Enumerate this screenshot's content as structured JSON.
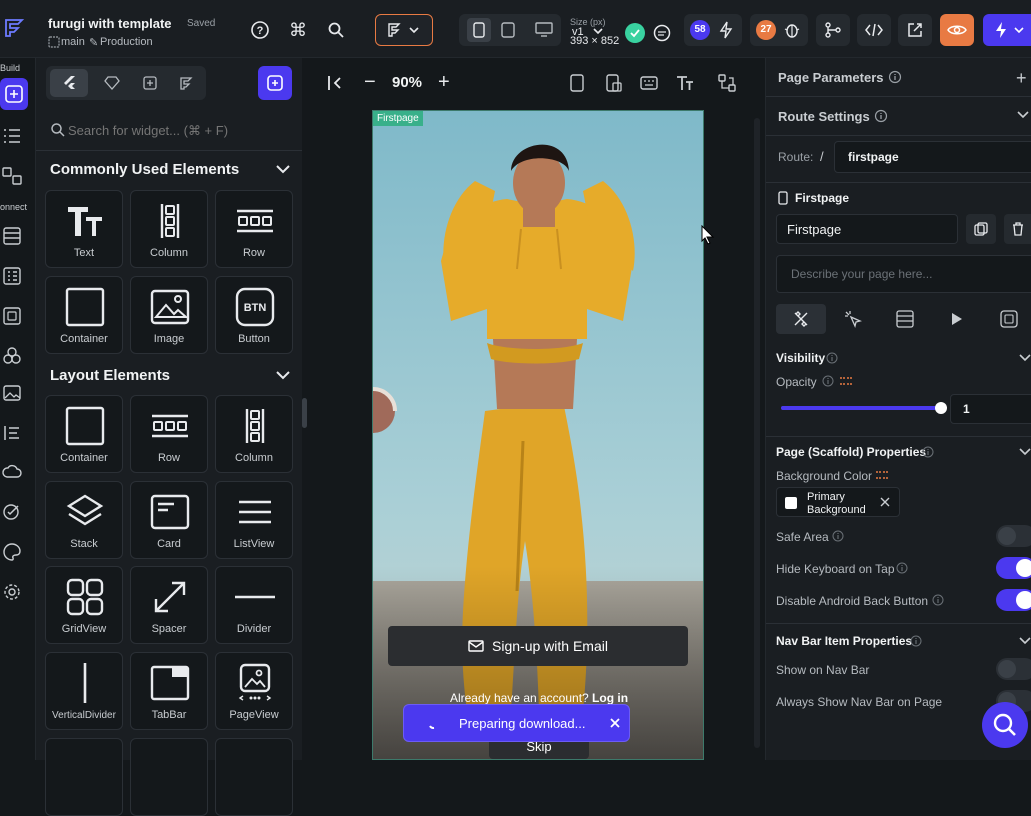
{
  "header": {
    "project_name": "furugi with template",
    "save_status": "Saved",
    "branch": "main",
    "environment": "Production",
    "size_label": "Size (px)",
    "size_value": "393 × 852",
    "version_label": "v1",
    "badge_count_blue": "58",
    "badge_count_orange": "27"
  },
  "rail": {
    "build_label": "Build",
    "connect_label": "onnect"
  },
  "widgets": {
    "search_placeholder": "Search for widget... (⌘ + F)",
    "common_title": "Commonly Used Elements",
    "common_items": [
      "Text",
      "Column",
      "Row",
      "Container",
      "Image",
      "Button"
    ],
    "layout_title": "Layout Elements",
    "layout_items": [
      "Container",
      "Row",
      "Column",
      "Stack",
      "Card",
      "ListView",
      "GridView",
      "Spacer",
      "Divider",
      "VerticalDivider",
      "TabBar",
      "PageView"
    ],
    "btn_icon_text": "BTN"
  },
  "canvas": {
    "zoom": "90%",
    "page_tag": "Firstpage",
    "signup_button": "Sign-up with Email",
    "already_text": "Already have an account?",
    "login_link": "Log in",
    "skip_text": "Skip",
    "toast_text": "Preparing download..."
  },
  "props": {
    "page_parameters": "Page Parameters",
    "route_settings": "Route Settings",
    "route_label": "Route:",
    "route_slash": "/",
    "route_value": "firstpage",
    "page_header": "Firstpage",
    "page_name_value": "Firstpage",
    "description_placeholder": "Describe your page here...",
    "visibility_title": "Visibility",
    "opacity_label": "Opacity",
    "opacity_value": "1",
    "opacity_fraction": 1,
    "scaffold_title": "Page (Scaffold) Properties",
    "bg_color_label": "Background Color",
    "bg_color_value_line1": "Primary",
    "bg_color_value_line2": "Background",
    "safe_area_label": "Safe Area",
    "hide_keyboard_label": "Hide Keyboard on Tap",
    "disable_back_label": "Disable Android Back Button",
    "navbar_title": "Nav Bar Item Properties",
    "show_navbar_label": "Show on Nav Bar",
    "always_show_label": "Always Show Nav Bar on Page"
  },
  "colors": {
    "accent": "#4b39ef",
    "active_orange": "#e87a43",
    "green": "#39d2a0"
  }
}
